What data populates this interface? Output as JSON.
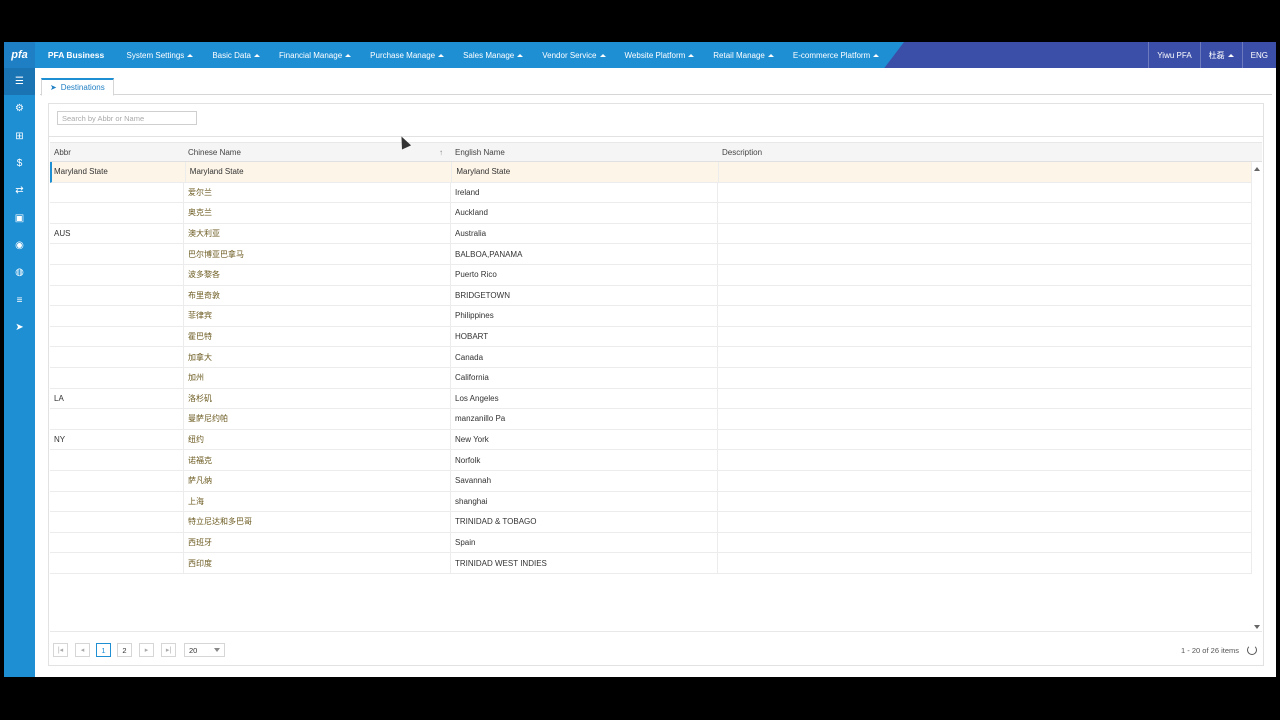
{
  "topbar": {
    "logo": "pfa",
    "brand": "PFA Business",
    "menu": [
      {
        "label": "System Settings"
      },
      {
        "label": "Basic Data"
      },
      {
        "label": "Financial Manage"
      },
      {
        "label": "Purchase Manage"
      },
      {
        "label": "Sales Manage"
      },
      {
        "label": "Vendor Service"
      },
      {
        "label": "Website Platform"
      },
      {
        "label": "Retail Manage"
      },
      {
        "label": "E-commerce Platform"
      }
    ],
    "company": "Yiwu PFA",
    "user": "杜磊",
    "language": "ENG"
  },
  "sidebar": {
    "icons": [
      "list-icon",
      "gear-icon",
      "sitemap-icon",
      "dollar-icon",
      "exchange-icon",
      "money-icon",
      "user-circle-icon",
      "globe-icon",
      "bars-icon",
      "paper-plane-icon"
    ],
    "glyphs": [
      "☰",
      "⚙",
      "⊞",
      "$",
      "⇄",
      "▣",
      "◉",
      "◍",
      "≡",
      "➤"
    ]
  },
  "tab": {
    "label": "Destinations",
    "icon": "➤"
  },
  "search": {
    "placeholder": "Search by Abbr or Name",
    "value": ""
  },
  "grid": {
    "columns": [
      "Abbr",
      "Chinese Name",
      "English Name",
      "Description"
    ],
    "sort_indicator": "↑",
    "rows": [
      {
        "abbr": "Maryland State",
        "cn": "Maryland State",
        "en": "Maryland State",
        "desc": ""
      },
      {
        "abbr": "",
        "cn": "爱尔兰",
        "en": "Ireland",
        "desc": ""
      },
      {
        "abbr": "",
        "cn": "奥克兰",
        "en": "Auckland",
        "desc": ""
      },
      {
        "abbr": "AUS",
        "cn": "澳大利亚",
        "en": "Australia",
        "desc": ""
      },
      {
        "abbr": "",
        "cn": "巴尔博亚巴拿马",
        "en": "BALBOA,PANAMA",
        "desc": ""
      },
      {
        "abbr": "",
        "cn": "波多黎各",
        "en": "Puerto Rico",
        "desc": ""
      },
      {
        "abbr": "",
        "cn": "布里奇敦",
        "en": "BRIDGETOWN",
        "desc": ""
      },
      {
        "abbr": "",
        "cn": "菲律宾",
        "en": "Philippines",
        "desc": ""
      },
      {
        "abbr": "",
        "cn": "霍巴特",
        "en": "HOBART",
        "desc": ""
      },
      {
        "abbr": "",
        "cn": "加拿大",
        "en": "Canada",
        "desc": ""
      },
      {
        "abbr": "",
        "cn": "加州",
        "en": "California",
        "desc": ""
      },
      {
        "abbr": "LA",
        "cn": "洛杉矶",
        "en": "Los Angeles",
        "desc": ""
      },
      {
        "abbr": "",
        "cn": "曼萨尼约帕",
        "en": "manzanillo Pa",
        "desc": ""
      },
      {
        "abbr": "NY",
        "cn": "纽约",
        "en": "New York",
        "desc": ""
      },
      {
        "abbr": "",
        "cn": "诺福克",
        "en": "Norfolk",
        "desc": ""
      },
      {
        "abbr": "",
        "cn": "萨凡纳",
        "en": "Savannah",
        "desc": ""
      },
      {
        "abbr": "",
        "cn": "上海",
        "en": "shanghai",
        "desc": ""
      },
      {
        "abbr": "",
        "cn": "特立尼达和多巴哥",
        "en": "TRINIDAD & TOBAGO",
        "desc": ""
      },
      {
        "abbr": "",
        "cn": "西班牙",
        "en": "Spain",
        "desc": ""
      },
      {
        "abbr": "",
        "cn": "西印度",
        "en": "TRINIDAD WEST INDIES",
        "desc": ""
      }
    ]
  },
  "pager": {
    "first": "|◂",
    "prev": "◂",
    "next": "▸",
    "last": "▸|",
    "pages": [
      "1",
      "2"
    ],
    "active_page": "1",
    "page_size": "20",
    "info": "1 - 20 of 26 items"
  }
}
